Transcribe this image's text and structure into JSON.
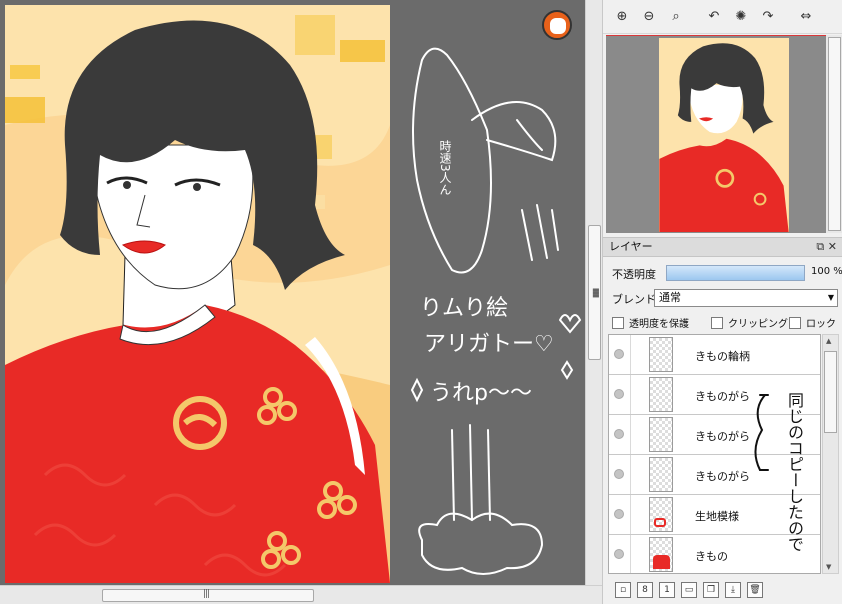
{
  "toolbar": {
    "buttons": [
      {
        "name": "zoom-in-icon",
        "glyph": "⊕"
      },
      {
        "name": "zoom-out-icon",
        "glyph": "⊖"
      },
      {
        "name": "zoom-reset-icon",
        "glyph": "⌕"
      },
      {
        "name": "rotate-left-icon",
        "glyph": "↶"
      },
      {
        "name": "rotate-reset-icon",
        "glyph": "✺"
      },
      {
        "name": "rotate-right-icon",
        "glyph": "↷"
      },
      {
        "name": "flip-horizontal-icon",
        "glyph": "⇔"
      }
    ]
  },
  "layers_panel": {
    "title": "レイヤー",
    "header_icons": "⧉ ✕",
    "opacity_label": "不透明度",
    "opacity_value": "100 %",
    "opacity_fraction": 1.0,
    "blend_label": "ブレンド",
    "blend_value": "通常",
    "checkboxes": {
      "protect_alpha": "透明度を保護",
      "clipping": "クリッピング",
      "lock": "ロック"
    },
    "layers": [
      {
        "name": "きもの輪柄",
        "thumb": "blank"
      },
      {
        "name": "きものがら",
        "thumb": "blank"
      },
      {
        "name": "きものがら",
        "thumb": "blank"
      },
      {
        "name": "きものがら",
        "thumb": "blank"
      },
      {
        "name": "生地模様",
        "thumb": "pattern"
      },
      {
        "name": "きもの",
        "thumb": "red"
      }
    ],
    "footer_buttons": [
      "new-layer",
      "new-8bit-layer",
      "new-1bit-layer",
      "new-folder",
      "copy-layer",
      "merge-down",
      "delete-layer"
    ],
    "footer_glyphs": [
      "▫",
      "8",
      "1",
      "▭",
      "❐",
      "⤓",
      "🗑"
    ]
  },
  "handwriting": {
    "canvas_doodle": [
      "時速3人ん",
      "りムり絵",
      "アリガトー♡",
      "うれp〜〜"
    ],
    "panel_note": "同じのコピーしたので"
  },
  "colors": {
    "kimono_red": "#e82a26",
    "pattern_gold": "#f4c86a",
    "background_peach": "#fbd48e",
    "hair_dark": "#3a3a3a",
    "canvas_gray": "#6b6b6b",
    "nav_border_red": "#d9383a"
  }
}
